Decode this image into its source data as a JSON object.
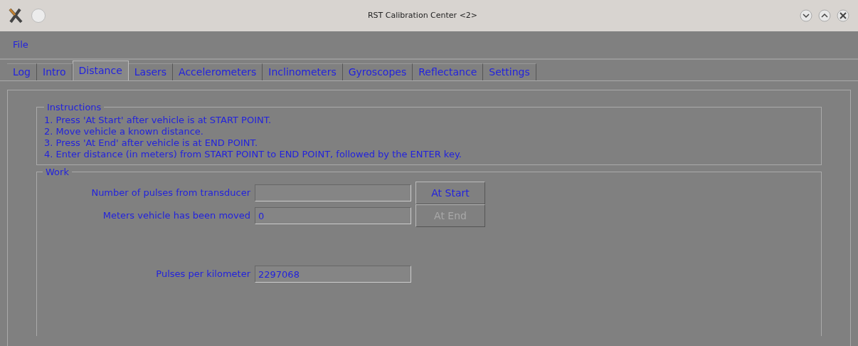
{
  "window": {
    "title": "RST Calibration Center <2>"
  },
  "menu": [
    "File"
  ],
  "tabs": [
    {
      "label": "Log",
      "selected": false
    },
    {
      "label": "Intro",
      "selected": false
    },
    {
      "label": "Distance",
      "selected": true
    },
    {
      "label": "Lasers",
      "selected": false
    },
    {
      "label": "Accelerometers",
      "selected": false
    },
    {
      "label": "Inclinometers",
      "selected": false
    },
    {
      "label": "Gyroscopes",
      "selected": false
    },
    {
      "label": "Reflectance",
      "selected": false
    },
    {
      "label": "Settings",
      "selected": false
    }
  ],
  "instructions": {
    "title": "Instructions",
    "lines": [
      "1. Press 'At Start' after vehicle is at START POINT.",
      "2. Move vehicle a known distance.",
      "3. Press 'At End' after vehicle is at END POINT.",
      "4. Enter distance (in meters) from START POINT to END POINT, followed by the ENTER key."
    ]
  },
  "work": {
    "title": "Work",
    "rows": [
      {
        "label": "Number of pulses from transducer",
        "button": {
          "label": "At Start",
          "disabled": false
        }
      },
      {
        "label": "Meters vehicle has been moved",
        "value": "0",
        "button": {
          "label": "At End",
          "disabled": true
        }
      },
      {
        "label": "Pulses per kilometer",
        "value": "2297068"
      }
    ]
  }
}
